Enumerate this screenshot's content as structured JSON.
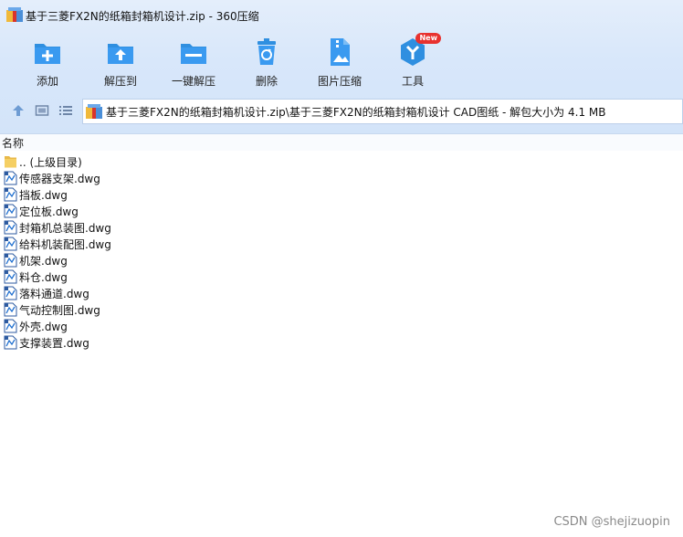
{
  "window": {
    "title": "基于三菱FX2N的纸箱封箱机设计.zip - 360压缩"
  },
  "toolbar": {
    "add_label": "添加",
    "extract_label": "解压到",
    "oneclick_label": "一键解压",
    "delete_label": "删除",
    "image_compress_label": "图片压缩",
    "tools_label": "工具",
    "tools_badge": "New"
  },
  "address": {
    "path": "基于三菱FX2N的纸箱封箱机设计.zip\\基于三菱FX2N的纸箱封箱机设计 CAD图纸 - 解包大小为 4.1 MB"
  },
  "columns": {
    "name": "名称"
  },
  "files": [
    {
      "name": ".. (上级目录)",
      "icon": "folder-icon"
    },
    {
      "name": "传感器支架.dwg",
      "icon": "dwg-file-icon"
    },
    {
      "name": "挡板.dwg",
      "icon": "dwg-file-icon"
    },
    {
      "name": "定位板.dwg",
      "icon": "dwg-file-icon"
    },
    {
      "name": "封箱机总装图.dwg",
      "icon": "dwg-file-icon"
    },
    {
      "name": "给料机装配图.dwg",
      "icon": "dwg-file-icon"
    },
    {
      "name": "机架.dwg",
      "icon": "dwg-file-icon"
    },
    {
      "name": "料仓.dwg",
      "icon": "dwg-file-icon"
    },
    {
      "name": "落料通道.dwg",
      "icon": "dwg-file-icon"
    },
    {
      "name": "气动控制图.dwg",
      "icon": "dwg-file-icon"
    },
    {
      "name": "外壳.dwg",
      "icon": "dwg-file-icon"
    },
    {
      "name": "支撑装置.dwg",
      "icon": "dwg-file-icon"
    }
  ],
  "watermark": "CSDN @shejizuopin",
  "colors": {
    "accent_blue": "#2f8fe0",
    "badge_red": "#e8322f",
    "folder_yellow": "#f5cf63"
  }
}
